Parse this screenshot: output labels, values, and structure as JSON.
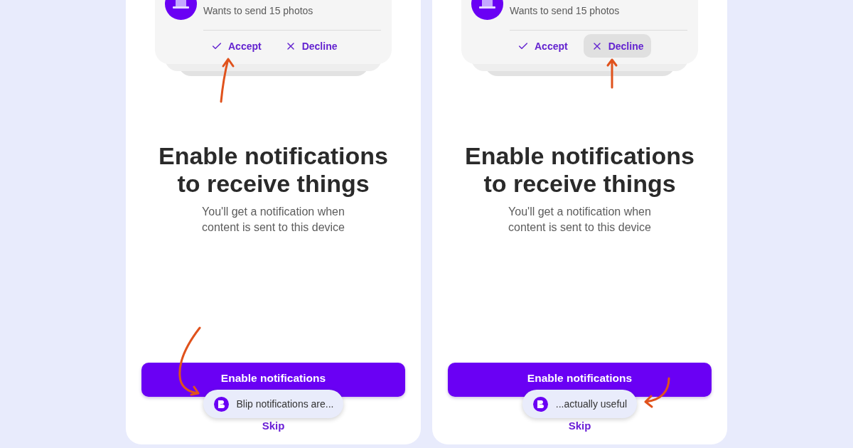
{
  "panels": [
    {
      "notification": {
        "message": "Wants to send 15 photos",
        "actions": [
          {
            "kind": "accept",
            "label": "Accept",
            "selected": false
          },
          {
            "kind": "decline",
            "label": "Decline",
            "selected": false
          }
        ]
      },
      "title": "Enable notifications to receive things",
      "subtitle": "You'll get a notification when content is sent to this device",
      "primary_button": "Enable notifications",
      "toast": "Blip notifications are...",
      "skip_link": "Skip"
    },
    {
      "notification": {
        "message": "Wants to send 15 photos",
        "actions": [
          {
            "kind": "accept",
            "label": "Accept",
            "selected": false
          },
          {
            "kind": "decline",
            "label": "Decline",
            "selected": true
          }
        ]
      },
      "title": "Enable notifications to receive things",
      "subtitle": "You'll get a notification when content is sent to this device",
      "primary_button": "Enable notifications",
      "toast": "...actually useful",
      "skip_link": "Skip"
    }
  ]
}
